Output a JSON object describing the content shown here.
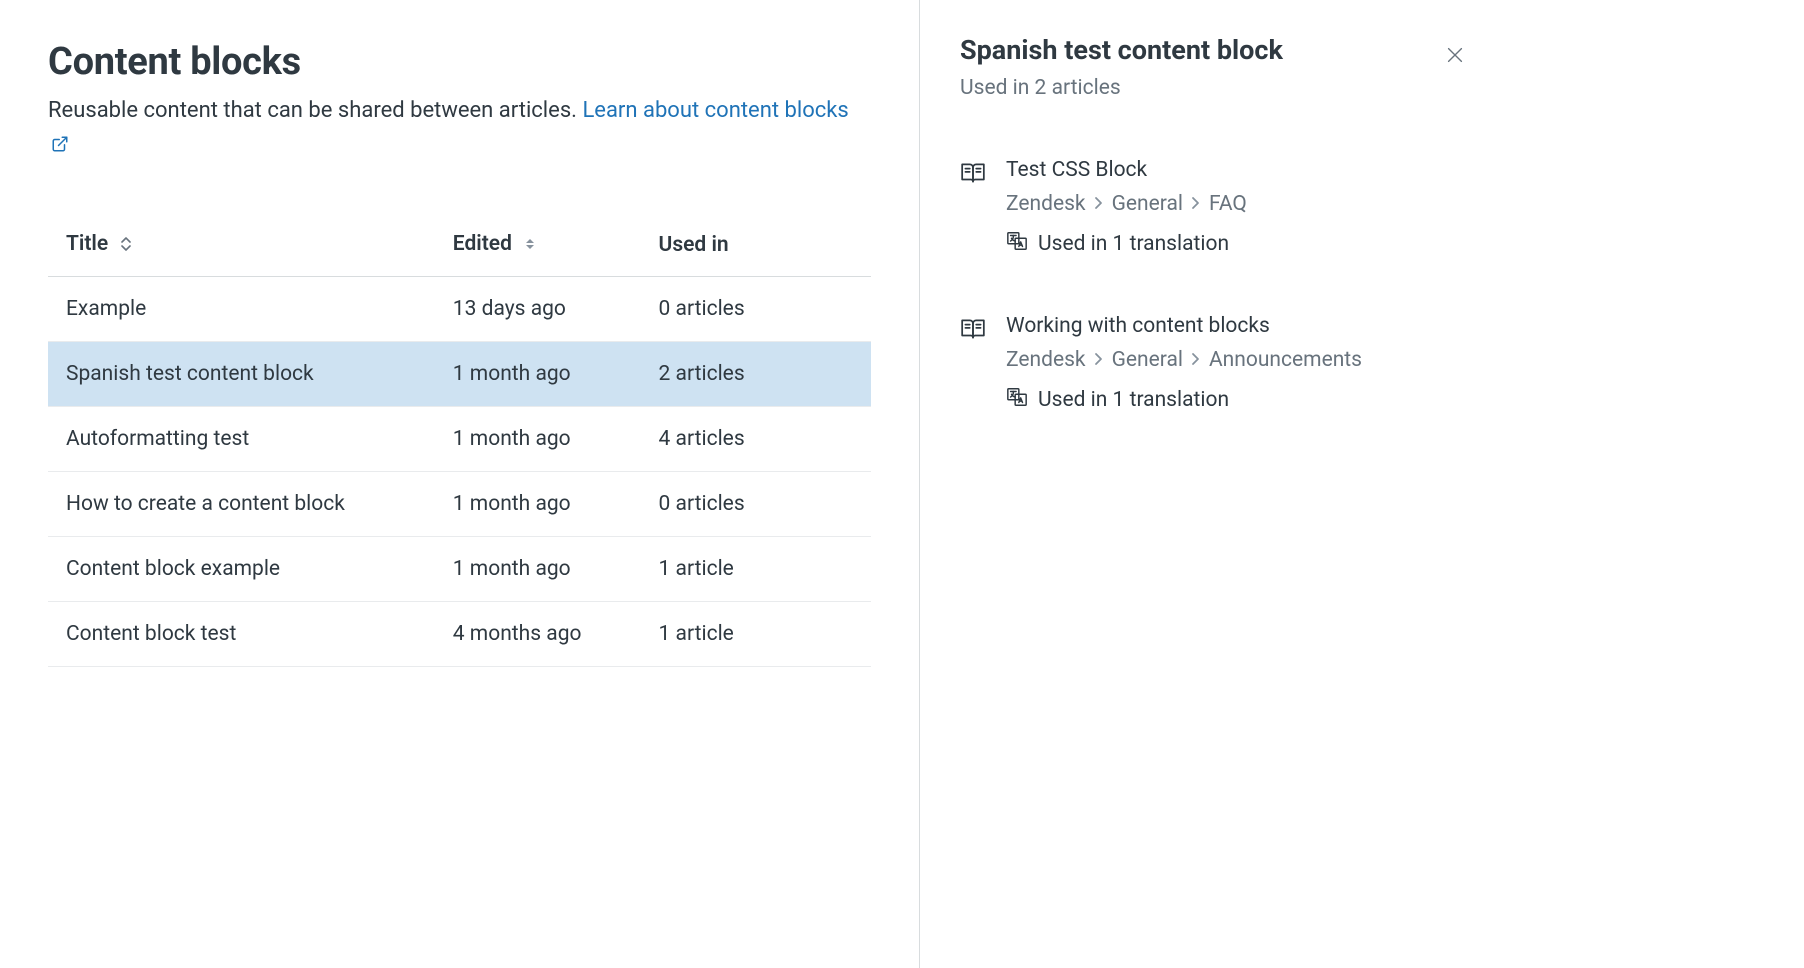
{
  "header": {
    "title": "Content blocks",
    "subtitle_lead": "Reusable content that can be shared between articles. ",
    "learn_link": "Learn about content blocks"
  },
  "table": {
    "columns": {
      "title": "Title",
      "edited": "Edited",
      "used_in": "Used in"
    },
    "rows": [
      {
        "title": "Example",
        "edited": "13 days ago",
        "used_in": "0 articles",
        "selected": false
      },
      {
        "title": "Spanish test content block",
        "edited": "1 month ago",
        "used_in": "2 articles",
        "selected": true
      },
      {
        "title": "Autoformatting test",
        "edited": "1 month ago",
        "used_in": "4 articles",
        "selected": false
      },
      {
        "title": "How to create a content block",
        "edited": "1 month ago",
        "used_in": "0 articles",
        "selected": false
      },
      {
        "title": "Content block example",
        "edited": "1 month ago",
        "used_in": "1 article",
        "selected": false
      },
      {
        "title": "Content block test",
        "edited": "4 months ago",
        "used_in": "1 article",
        "selected": false
      }
    ]
  },
  "detail": {
    "title": "Spanish test content block",
    "subtitle": "Used in 2 articles",
    "articles": [
      {
        "title": "Test CSS Block",
        "breadcrumb": [
          "Zendesk",
          "General",
          "FAQ"
        ],
        "translation": "Used in 1 translation"
      },
      {
        "title": "Working with content blocks",
        "breadcrumb": [
          "Zendesk",
          "General",
          "Announcements"
        ],
        "translation": "Used in 1 translation"
      }
    ]
  }
}
